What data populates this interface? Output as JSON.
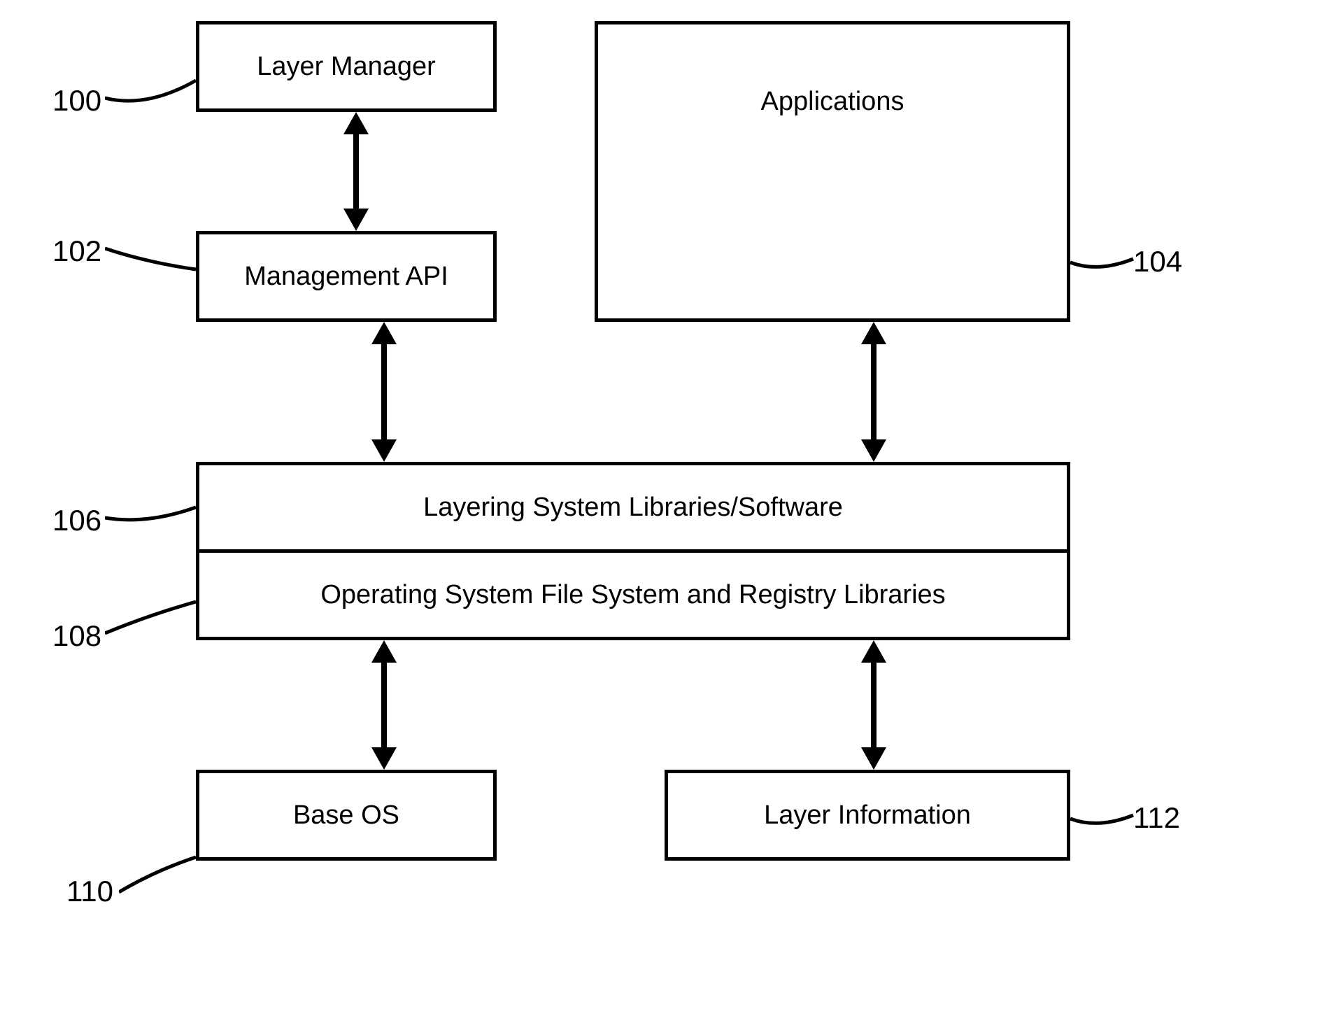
{
  "boxes": {
    "layer_manager": "Layer Manager",
    "applications": "Applications",
    "management_api": "Management API",
    "layering_libraries": "Layering System Libraries/Software",
    "os_libraries": "Operating System File System and Registry Libraries",
    "base_os": "Base OS",
    "layer_information": "Layer Information"
  },
  "refs": {
    "ref_100": "100",
    "ref_102": "102",
    "ref_104": "104",
    "ref_106": "106",
    "ref_108": "108",
    "ref_110": "110",
    "ref_112": "112"
  }
}
